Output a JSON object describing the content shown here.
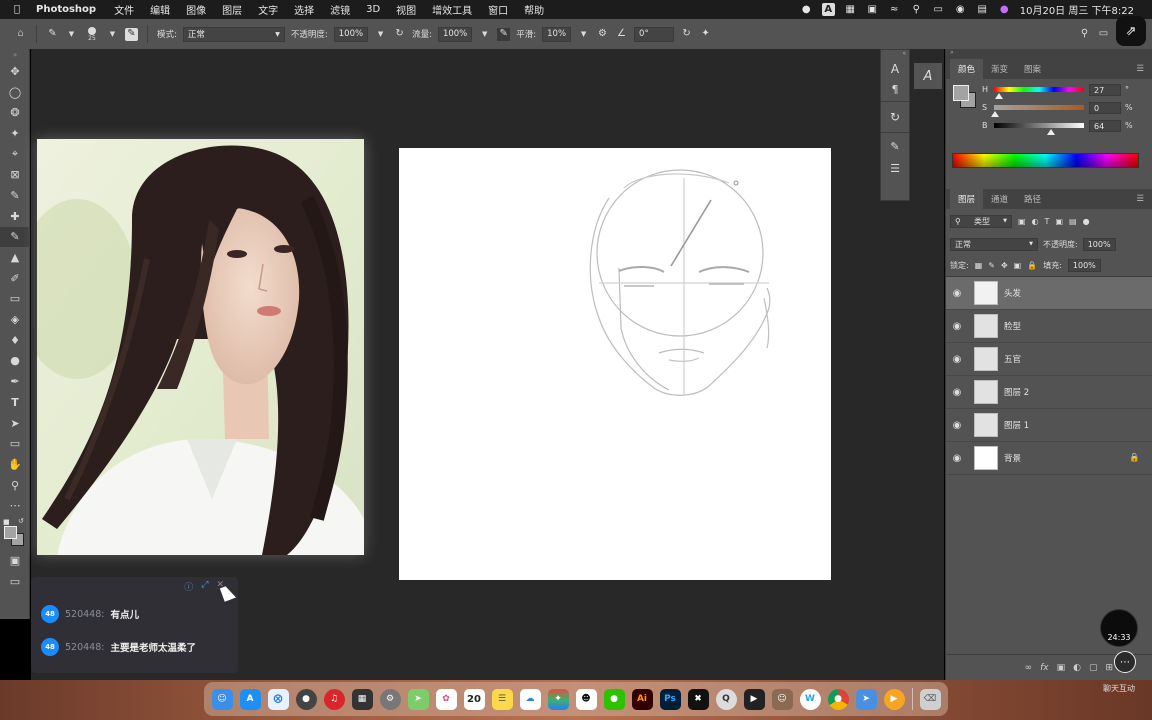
{
  "menubar": {
    "apple": "",
    "app": "Photoshop",
    "items": [
      "文件",
      "编辑",
      "图像",
      "图层",
      "文字",
      "选择",
      "滤镜",
      "3D",
      "视图",
      "增效工具",
      "窗口",
      "帮助"
    ],
    "clock": "10月20日 周三 下午8:22"
  },
  "options": {
    "brush_size": "25",
    "mode_label": "模式:",
    "mode_value": "正常",
    "opacity_label": "不透明度:",
    "opacity_value": "100%",
    "flow_label": "流量:",
    "flow_value": "100%",
    "smooth_label": "平滑:",
    "smooth_value": "10%",
    "angle_value": "0°"
  },
  "color_panel": {
    "tabs": [
      "颜色",
      "渐变",
      "图案"
    ],
    "h_label": "H",
    "h_value": "27",
    "h_unit": "°",
    "s_label": "S",
    "s_value": "0",
    "s_unit": "%",
    "b_label": "B",
    "b_value": "64",
    "b_unit": "%"
  },
  "layers_panel": {
    "tabs": [
      "图层",
      "通道",
      "路径"
    ],
    "filter_label": "类型",
    "blend_mode": "正常",
    "opacity_label": "不透明度:",
    "opacity_value": "100%",
    "lock_label": "锁定:",
    "fill_label": "填充:",
    "fill_value": "100%",
    "layers": [
      {
        "name": "头发"
      },
      {
        "name": "脸型"
      },
      {
        "name": "五官"
      },
      {
        "name": "图层 2"
      },
      {
        "name": "图层 1"
      },
      {
        "name": "背景"
      }
    ]
  },
  "chat": {
    "messages": [
      {
        "level": "48",
        "user": "520448:",
        "text": "有点儿"
      },
      {
        "level": "48",
        "user": "520448:",
        "text": "主要是老师太温柔了"
      }
    ]
  },
  "timer": "24:33",
  "watermark": "聊天互动",
  "dock": {
    "calendar_day": "20",
    "apps": [
      "Ai",
      "Ps"
    ]
  },
  "colors": {
    "menubar": "#1c1c1c",
    "panel": "#535353",
    "workspace": "#282828",
    "accent_chat": "#1a8cff"
  }
}
